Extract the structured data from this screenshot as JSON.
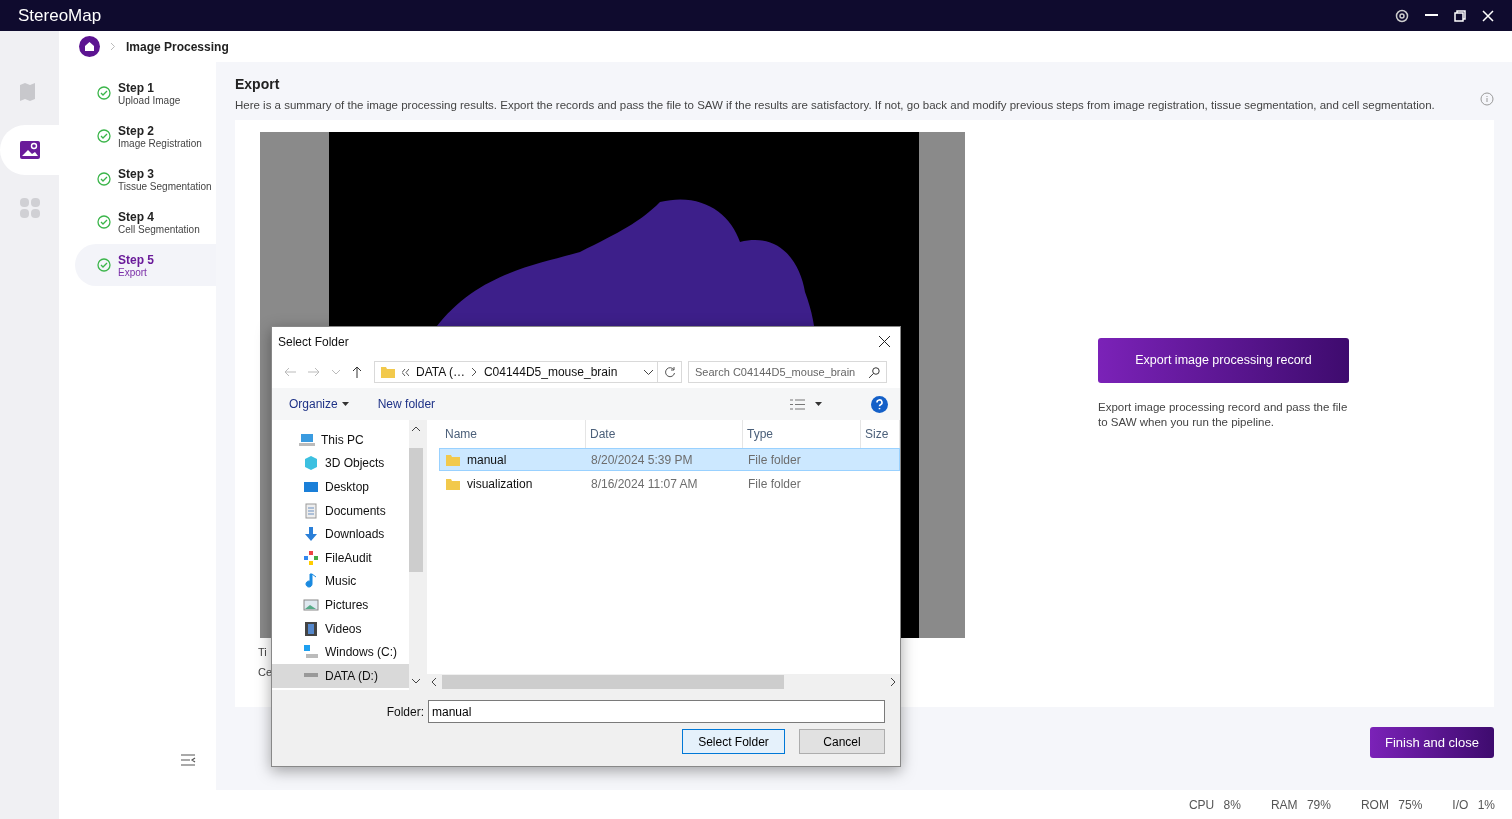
{
  "app": {
    "title": "StereoMap"
  },
  "rail": [
    {
      "kind": "map",
      "selected": false
    },
    {
      "kind": "image",
      "selected": true
    },
    {
      "kind": "apps",
      "selected": false
    }
  ],
  "breadcrumb": {
    "current": "Image Processing"
  },
  "steps": [
    {
      "title": "Step 1",
      "subtitle": "Upload Image",
      "done": true,
      "selected": false
    },
    {
      "title": "Step 2",
      "subtitle": "Image Registration",
      "done": true,
      "selected": false
    },
    {
      "title": "Step 3",
      "subtitle": "Tissue Segmentation",
      "done": true,
      "selected": false
    },
    {
      "title": "Step 4",
      "subtitle": "Cell Segmentation",
      "done": true,
      "selected": false
    },
    {
      "title": "Step 5",
      "subtitle": "Export",
      "done": true,
      "selected": true
    }
  ],
  "export": {
    "heading": "Export",
    "description": "Here is a summary of the image processing results. Export the records and pass the file to SAW if the results are satisfactory. If not, go back and modify previous steps from image registration, tissue segmentation, and cell segmentation.",
    "preview_labels": [
      "Ti",
      "Ce"
    ],
    "button": "Export image processing record",
    "note": "Export image processing record and pass the file to SAW when you run the pipeline."
  },
  "finish_button": "Finish and close",
  "status_bar": [
    {
      "label": "CPU",
      "value": "8%"
    },
    {
      "label": "RAM",
      "value": "79%"
    },
    {
      "label": "ROM",
      "value": "75%"
    },
    {
      "label": "I/O",
      "value": "1%"
    }
  ],
  "dialog": {
    "title": "Select Folder",
    "path": [
      "DATA (…",
      "C04144D5_mouse_brain"
    ],
    "search_placeholder": "Search C04144D5_mouse_brain",
    "toolbar": [
      "Organize",
      "New folder"
    ],
    "tree": [
      {
        "label": "This PC",
        "kind": "pc",
        "selected": false,
        "children": [
          {
            "label": "3D Objects",
            "kind": "cube",
            "selected": false
          },
          {
            "label": "Desktop",
            "kind": "desktop",
            "selected": false
          },
          {
            "label": "Documents",
            "kind": "documents",
            "selected": false
          },
          {
            "label": "Downloads",
            "kind": "downloads",
            "selected": false
          },
          {
            "label": "FileAudit",
            "kind": "app",
            "selected": false
          },
          {
            "label": "Music",
            "kind": "music",
            "selected": false
          },
          {
            "label": "Pictures",
            "kind": "pictures",
            "selected": false
          },
          {
            "label": "Videos",
            "kind": "videos",
            "selected": false
          },
          {
            "label": "Windows (C:)",
            "kind": "windows-drive",
            "selected": false
          },
          {
            "label": "DATA (D:)",
            "kind": "drive",
            "selected": true
          }
        ]
      }
    ],
    "columns": [
      "Name",
      "Date",
      "Type",
      "Size"
    ],
    "rows": [
      {
        "name": "manual",
        "date": "8/20/2024 5:39 PM",
        "type": "File folder",
        "selected": true
      },
      {
        "name": "visualization",
        "date": "8/16/2024 11:07 AM",
        "type": "File folder",
        "selected": false
      }
    ],
    "folder_label": "Folder:",
    "folder_value": "manual",
    "buttons": [
      {
        "label": "Select Folder",
        "default": true
      },
      {
        "label": "Cancel",
        "default": false
      }
    ]
  }
}
